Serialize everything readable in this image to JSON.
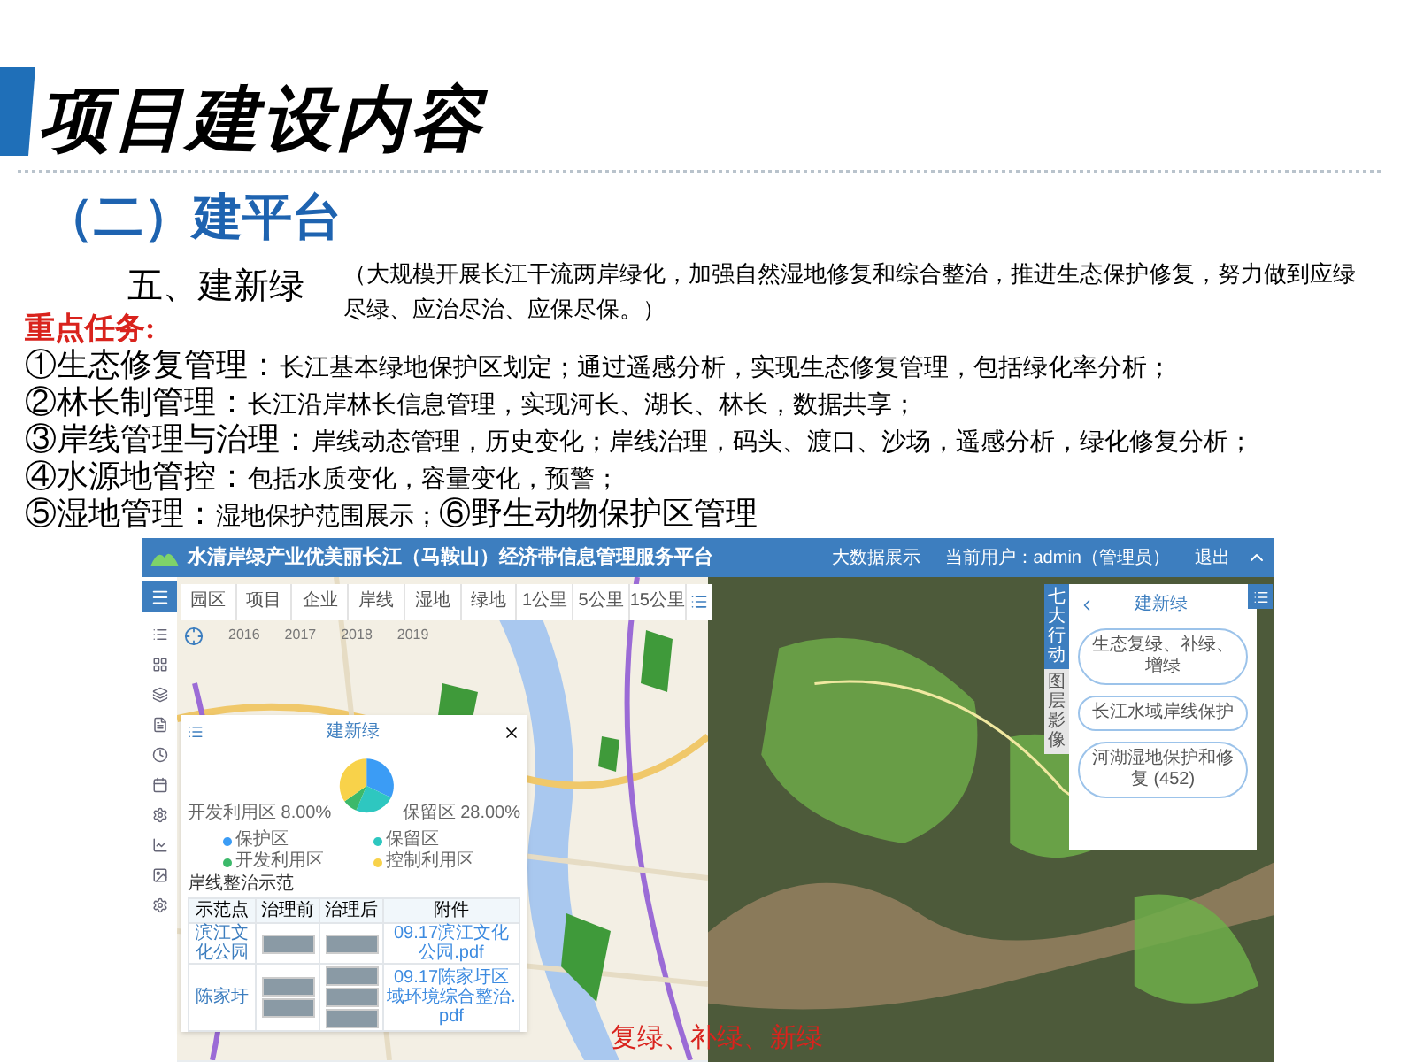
{
  "header": {
    "title": "项目建设内容",
    "subtitle": "（二）建平台"
  },
  "section": {
    "heading": "五、建新绿",
    "note": "（大规模开展长江干流两岸绿化，加强自然湿地修复和综合整治，推进生态保护修复，努力做到应绿尽绿、应治尽治、应保尽保。）"
  },
  "tasks": {
    "label": "重点任务:",
    "items": [
      {
        "number": "①",
        "name": "生态修复管理：",
        "detail": "长江基本绿地保护区划定；通过遥感分析，实现生态修复管理，包括绿化率分析；"
      },
      {
        "number": "②",
        "name": "林长制管理：",
        "detail": "长江沿岸林长信息管理，实现河长、湖长、林长，数据共享；"
      },
      {
        "number": "③",
        "name": "岸线管理与治理：",
        "detail": "岸线动态管理，历史变化；岸线治理，码头、渡口、沙场，遥感分析，绿化修复分析；"
      },
      {
        "number": "④",
        "name": "水源地管控：",
        "detail": "包括水质变化，容量变化，预警；"
      },
      {
        "number": "⑤",
        "name": "湿地管理：",
        "detail": "湿地保护范围展示；",
        "extra": "⑥野生动物保护区管理"
      }
    ]
  },
  "app": {
    "title": "水清岸绿产业优美丽长江（马鞍山）经济带信息管理服务平台",
    "top_links": [
      "大数据展示",
      "当前用户：admin（管理员）",
      "退出"
    ],
    "map_tabs": [
      "园区",
      "项目",
      "企业",
      "岸线",
      "湿地",
      "绿地",
      "1公里",
      "5公里",
      "15公里"
    ],
    "timeline": [
      "2016",
      "2017",
      "2018",
      "2019"
    ],
    "popup": {
      "title": "建新绿",
      "pie_labels": [
        "开发利用区 8.00%",
        "保留区 28.00%"
      ],
      "legend": [
        {
          "label": "保护区",
          "color": "#3b9cf5"
        },
        {
          "label": "保留区",
          "color": "#2ec7c0"
        },
        {
          "label": "开发利用区",
          "color": "#3cb96a"
        },
        {
          "label": "控制利用区",
          "color": "#f8d24a"
        }
      ],
      "table_title": "岸线整治示范",
      "columns": [
        "示范点",
        "治理前",
        "治理后",
        "附件"
      ],
      "rows": [
        {
          "site": "滨江文化公园",
          "before": [
            {
              "kind": "photo"
            }
          ],
          "after": [
            {
              "kind": "photo"
            }
          ],
          "file": "09.17滨江文化公园.pdf"
        },
        {
          "site": "陈家圩",
          "before": [
            {
              "kind": "photo"
            },
            {
              "kind": "photo"
            }
          ],
          "after": [
            {
              "kind": "photo"
            },
            {
              "kind": "photo"
            },
            {
              "kind": "photo"
            }
          ],
          "file": "09.17陈家圩区域环境综合整治.pdf"
        }
      ]
    },
    "side_tabs": [
      {
        "label": "七大行动",
        "selected": true
      },
      {
        "label": "图层影像",
        "selected": false
      }
    ],
    "panel": {
      "title": "建新绿",
      "actions": [
        "生态复绿、补绿、增绿",
        "长江水域岸线保护",
        "河湖湿地保护和修复 (452)"
      ]
    },
    "caption": "复绿、补绿、新绿"
  }
}
